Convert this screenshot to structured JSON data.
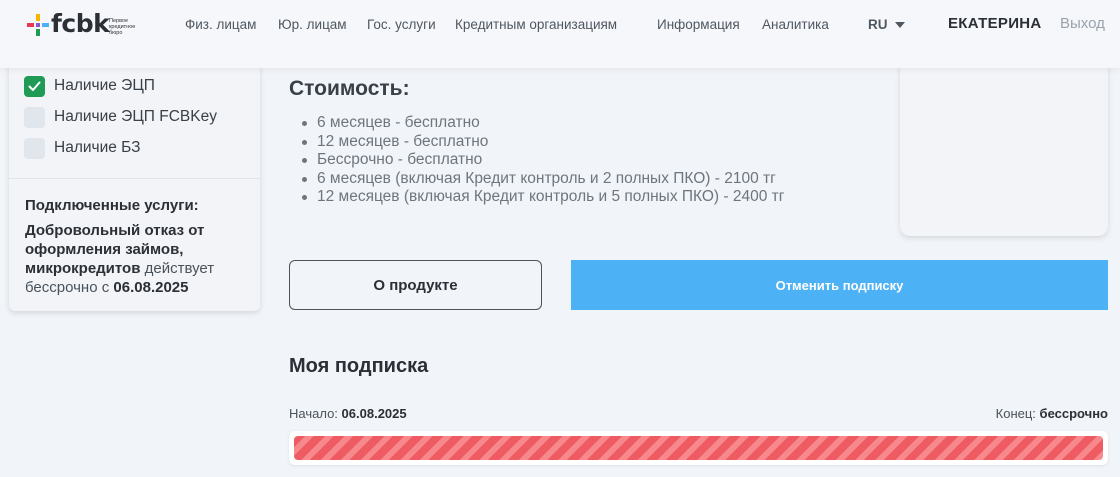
{
  "header": {
    "logo_text": "fcbk",
    "logo_subtitle": "Первое кредитное бюро",
    "nav": [
      "Физ. лицам",
      "Юр. лицам",
      "Гос. услуги",
      "Кредитным организациям",
      "Информация",
      "Аналитика"
    ],
    "language": "RU",
    "user_name": "ЕКАТЕРИНА",
    "logout": "Выход"
  },
  "sidebar": {
    "checks": [
      {
        "label": "Наличие ЭЦП",
        "checked": true
      },
      {
        "label": "Наличие ЭЦП FCBKey",
        "checked": false
      },
      {
        "label": "Наличие БЗ",
        "checked": false
      }
    ],
    "services_title": "Подключенные услуги:",
    "service_name": "Добровольный отказ от оформления займов, микрокредитов",
    "service_status": "действует бессрочно с",
    "service_date": "06.08.2025"
  },
  "pricing": {
    "title": "Стоимость:",
    "items": [
      "6 месяцев - бесплатно",
      "12 месяцев - бесплатно",
      "Бессрочно - бесплатно",
      "6 месяцев (включая Кредит контроль и 2 полных ПКО) - 2100 тг",
      "12 месяцев (включая Кредит контроль и 5 полных ПКО) - 2400 тг"
    ]
  },
  "buttons": {
    "about": "О продукте",
    "cancel": "Отменить подписку"
  },
  "subscription": {
    "title": "Моя подписка",
    "start_label": "Начало:",
    "start_value": "06.08.2025",
    "end_label": "Конец:",
    "end_value": "бессрочно",
    "progress": 1.0
  },
  "colors": {
    "accent_blue": "#4cb1f5",
    "check_green": "#1f9b55",
    "progress_red": "#ef5b62"
  }
}
